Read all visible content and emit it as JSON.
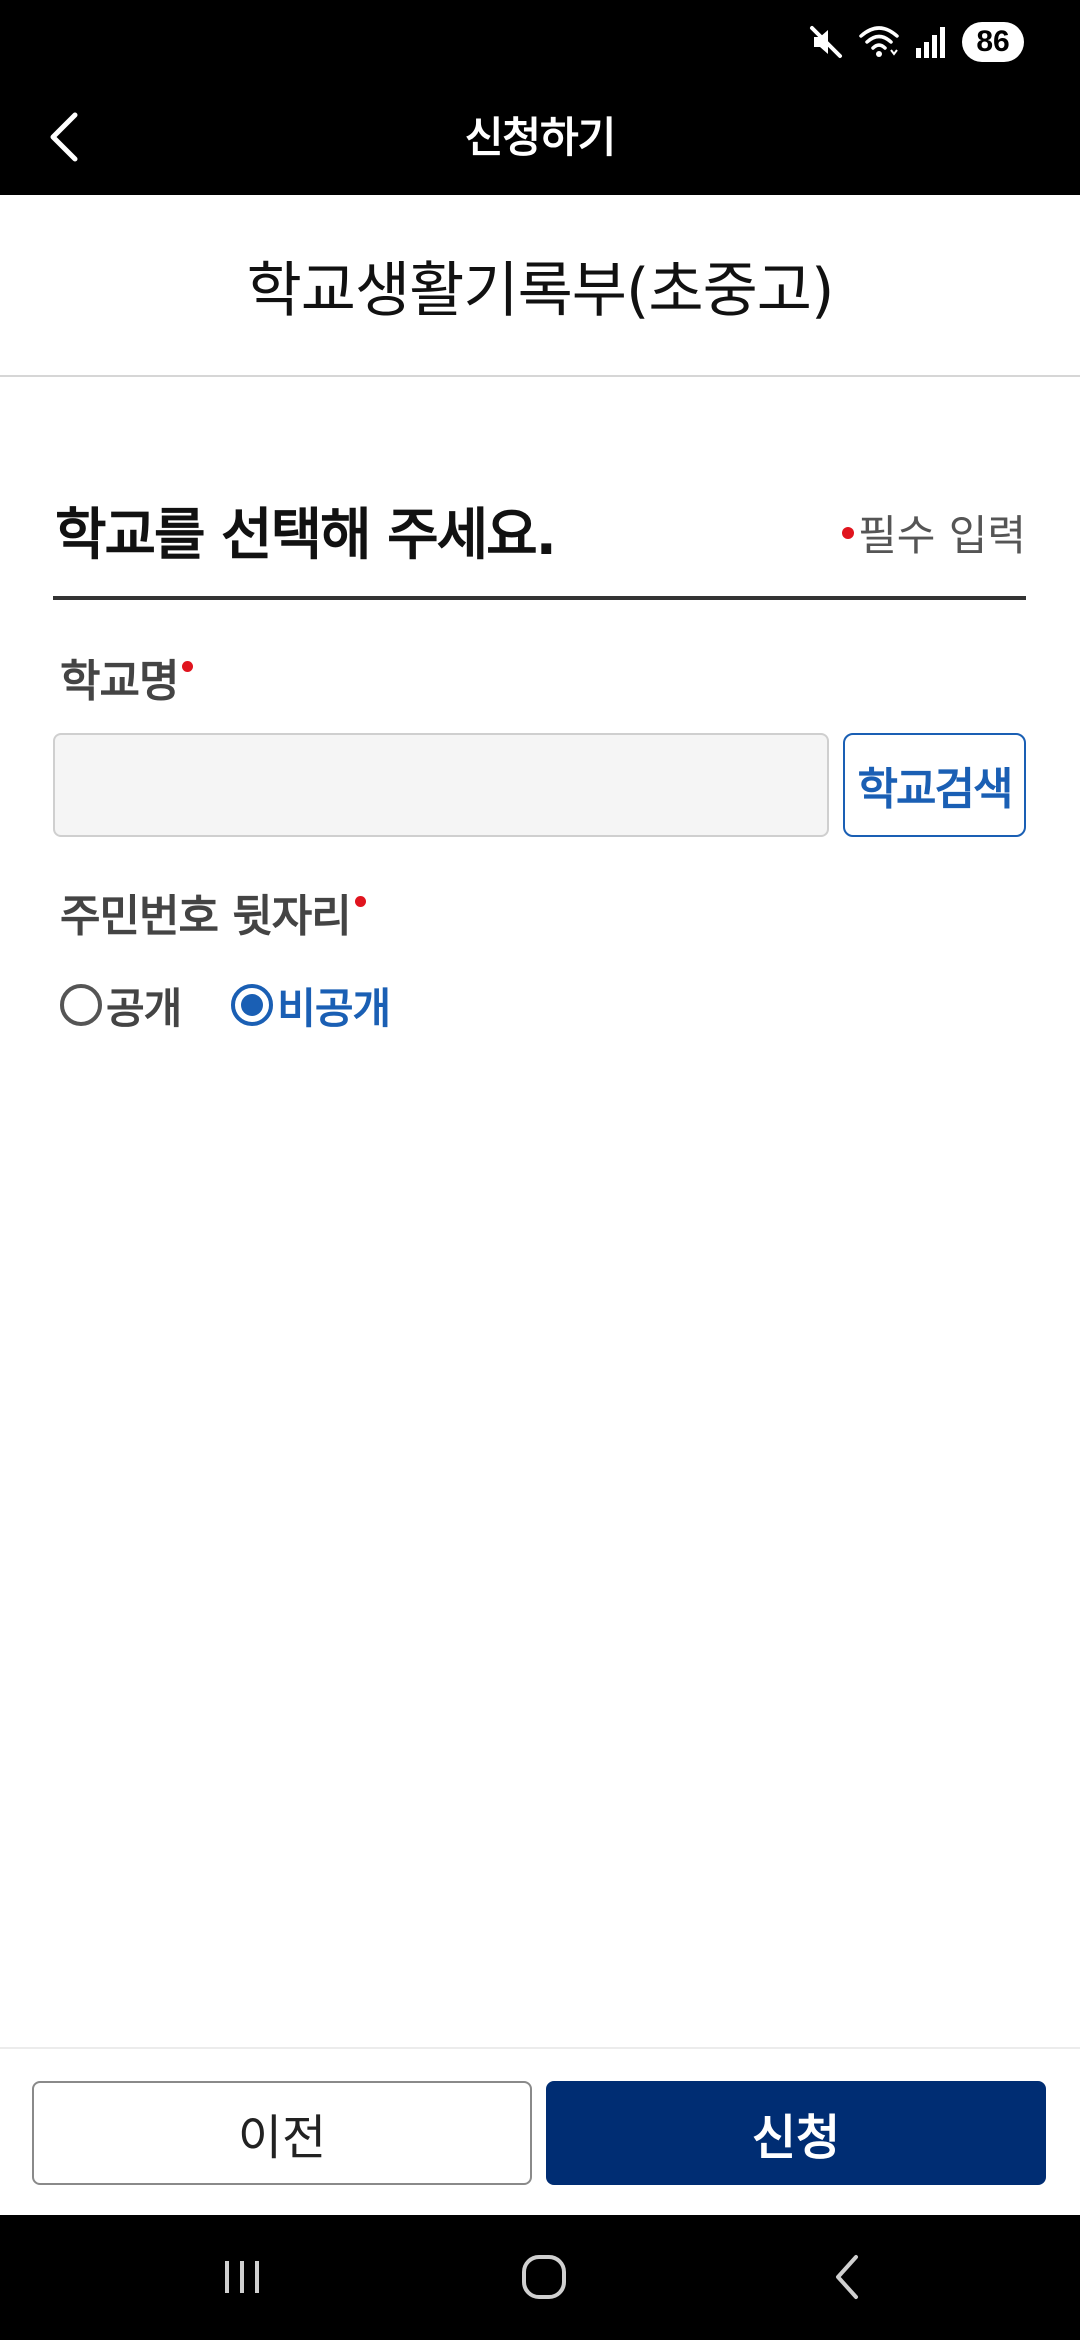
{
  "status_bar": {
    "battery_level": "86",
    "icons": [
      "mute-icon",
      "wifi-icon",
      "signal-icon",
      "battery-icon"
    ]
  },
  "app_bar": {
    "title": "신청하기",
    "back_icon": "chevron-left-icon"
  },
  "document": {
    "title": "학교생활기록부(초중고)"
  },
  "section": {
    "title": "학교를 선택해 주세요.",
    "required_note": "필수 입력"
  },
  "fields": {
    "school_name": {
      "label": "학교명",
      "value": "",
      "placeholder": "",
      "search_button": "학교검색"
    },
    "ssn_back": {
      "label": "주민번호 뒷자리",
      "options": [
        {
          "label": "공개",
          "selected": false
        },
        {
          "label": "비공개",
          "selected": true
        }
      ]
    }
  },
  "actions": {
    "prev_label": "이전",
    "apply_label": "신청"
  },
  "colors": {
    "primary": "#002d73",
    "accent_blue": "#1a5fb4",
    "required_red": "#e0141e"
  },
  "nav_bar": {
    "icons": [
      "recents-icon",
      "home-icon",
      "back-icon"
    ]
  }
}
